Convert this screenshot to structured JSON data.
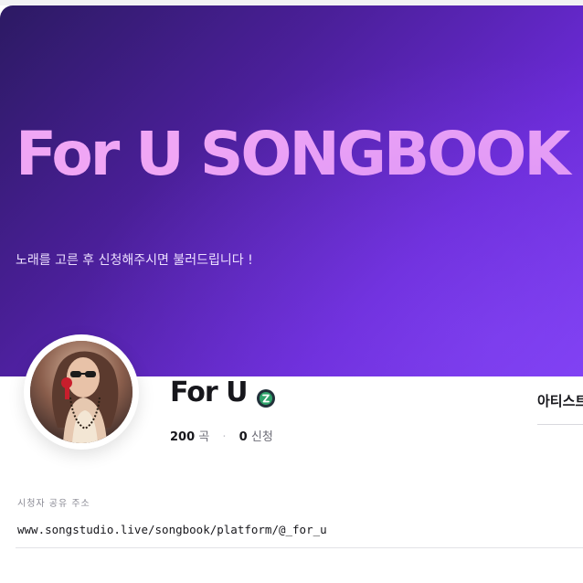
{
  "banner": {
    "title": "For U SONGBOOK",
    "subtitle": "노래를 고른 후 신청해주시면 불러드립니다 !"
  },
  "profile": {
    "name": "For U",
    "verified_icon": "verified-badge-icon",
    "songs_count": "200",
    "songs_unit": "곡",
    "requests_count": "0",
    "requests_unit": "신청",
    "separator": "·"
  },
  "nav": {
    "artist_link_label": "아티스트"
  },
  "share": {
    "label": "시청자 공유 주소",
    "url": "www.songstudio.live/songbook/platform/@_for_u"
  },
  "colors": {
    "banner_start": "#2c1a63",
    "banner_end": "#7d3cf0",
    "title_pink": "#f0a6f5",
    "verified_green": "#2fa36b"
  }
}
